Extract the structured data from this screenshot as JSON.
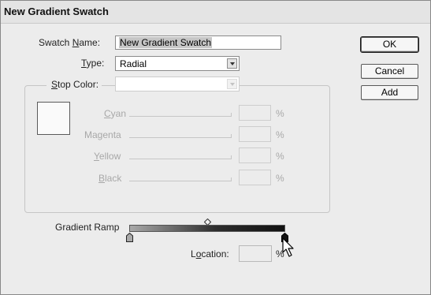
{
  "dialog": {
    "title": "New Gradient Swatch"
  },
  "swatch_name": {
    "label_pre": "Swatch ",
    "label_key": "N",
    "label_post": "ame:",
    "value": "New Gradient Swatch"
  },
  "type": {
    "label_key": "T",
    "label_post": "ype:",
    "value": "Radial"
  },
  "stop_color": {
    "label_key": "S",
    "label_post": "top Color:",
    "value": ""
  },
  "channels": [
    {
      "label_key": "C",
      "label_post": "yan",
      "value": "",
      "unit": "%"
    },
    {
      "label_pre": "Ma",
      "label_key": "g",
      "label_post": "enta",
      "value": "",
      "unit": "%"
    },
    {
      "label_key": "Y",
      "label_post": "ellow",
      "value": "",
      "unit": "%"
    },
    {
      "label_key": "B",
      "label_post": "lack",
      "value": "",
      "unit": "%"
    }
  ],
  "gradient_ramp": {
    "label": "Gradient Ramp"
  },
  "location": {
    "label_pre": "L",
    "label_key": "o",
    "label_post": "cation:",
    "value": "",
    "unit": "%"
  },
  "buttons": {
    "ok": "OK",
    "cancel": "Cancel",
    "add": "Add"
  }
}
